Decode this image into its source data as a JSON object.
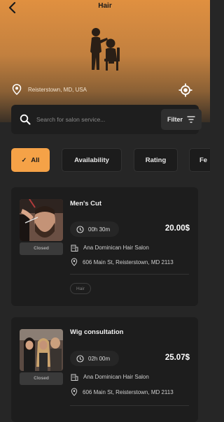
{
  "header": {
    "title": "Hair",
    "location": "Reisterstown, MD, USA"
  },
  "search": {
    "placeholder": "Search for salon service...",
    "filter_label": "Filter"
  },
  "chips": [
    {
      "label": "All",
      "active": true
    },
    {
      "label": "Availability",
      "active": false
    },
    {
      "label": "Rating",
      "active": false
    },
    {
      "label": "Fe",
      "active": false
    }
  ],
  "services": [
    {
      "name": "Men's Cut",
      "status": "Closed",
      "duration": "00h 30m",
      "price": "20.00$",
      "salon": "Ana Dominican Hair Salon",
      "address": "606 Main St, Reisterstown, MD 2113",
      "tag": "Hair"
    },
    {
      "name": "Wig consultation",
      "status": "Closed",
      "duration": "02h 00m",
      "price": "25.07$",
      "salon": "Ana Dominican Hair Salon",
      "address": "606 Main St, Reisterstown, MD 2113"
    }
  ],
  "colors": {
    "accent": "#f5a247",
    "background": "#262626",
    "card": "#1d1d1d"
  }
}
